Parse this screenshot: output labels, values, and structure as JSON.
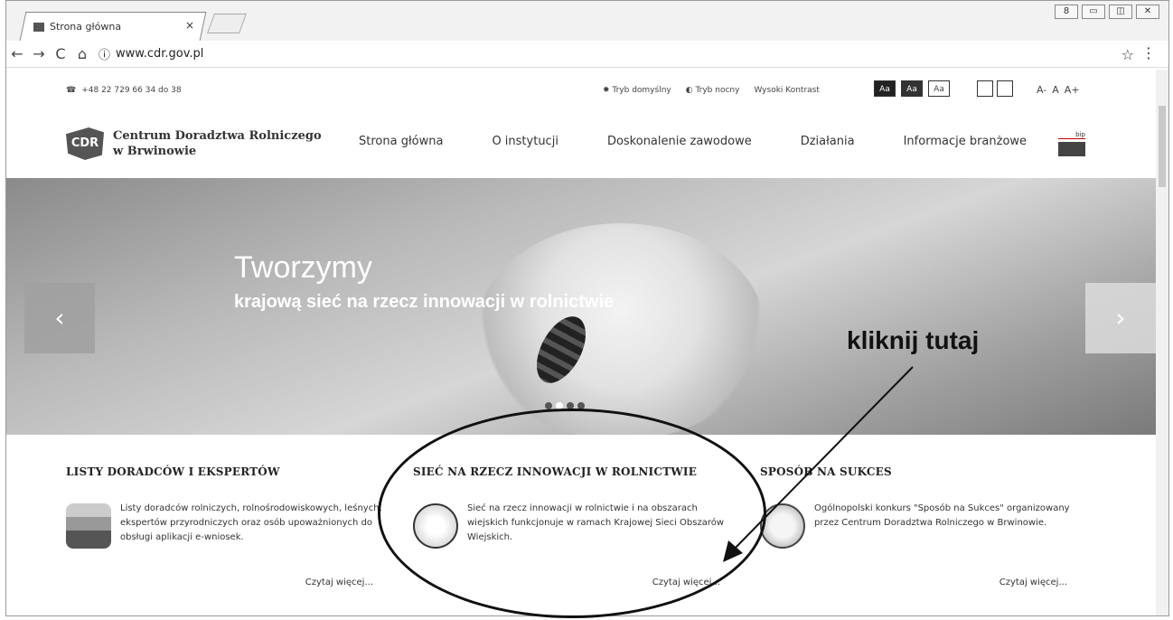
{
  "browser": {
    "tab_title": "Strona główna",
    "tab_close": "×",
    "url": "www.cdr.gov.pl",
    "nav": {
      "back": "←",
      "forward": "→",
      "reload": "C",
      "home": "⌂",
      "info": "ⓘ"
    },
    "star": "☆",
    "menu": "⋮",
    "window_buttons": [
      "8",
      "▭",
      "◫",
      "✕"
    ]
  },
  "topbar": {
    "phone_icon": "☎",
    "phone": "+48 22 729 66 34 do 38",
    "modes": [
      {
        "icon": "✹",
        "label": "Tryb domyślny"
      },
      {
        "icon": "◐",
        "label": "Tryb nocny"
      },
      {
        "icon": "",
        "label": "Wysoki Kontrast"
      }
    ],
    "aa_buttons": [
      "Aa",
      "Aa",
      "Aa"
    ],
    "font_size": [
      "A-",
      "A",
      "A+"
    ]
  },
  "header": {
    "logo_mark": "CDR",
    "logo_line1": "Centrum Doradztwa Rolniczego",
    "logo_line2": "w Brwinowie",
    "nav": [
      "Strona główna",
      "O instytucji",
      "Doskonalenie zawodowe",
      "Działania",
      "Informacje branżowe"
    ],
    "bip": "bip"
  },
  "hero": {
    "title": "Tworzymy",
    "subtitle": "krajową sieć na rzecz innowacji w rolnictwie",
    "prev": "‹",
    "next": "›",
    "annotation": "kliknij tutaj"
  },
  "columns": [
    {
      "heading": "LISTY DORADCÓW I EKSPERTÓW",
      "text": "Listy doradców rolniczych, rolnośrodowiskowych, leśnych, ekspertów przyrodniczych oraz osób upoważnionych do obsługi aplikacji e-wniosek.",
      "more": "Czytaj więcej..."
    },
    {
      "heading": "SIEĆ NA RZECZ INNOWACJI W ROLNICTWIE",
      "text": "Sieć na rzecz innowacji w rolnictwie i na obszarach wiejskich funkcjonuje w ramach Krajowej Sieci Obszarów Wiejskich.",
      "more": "Czytaj więcej..."
    },
    {
      "heading": "SPOSÓB NA SUKCES",
      "text": "Ogólnopolski konkurs \"Sposób na Sukces\" organizowany przez Centrum Doradztwa Rolniczego w Brwinowie.",
      "more": "Czytaj więcej..."
    }
  ]
}
